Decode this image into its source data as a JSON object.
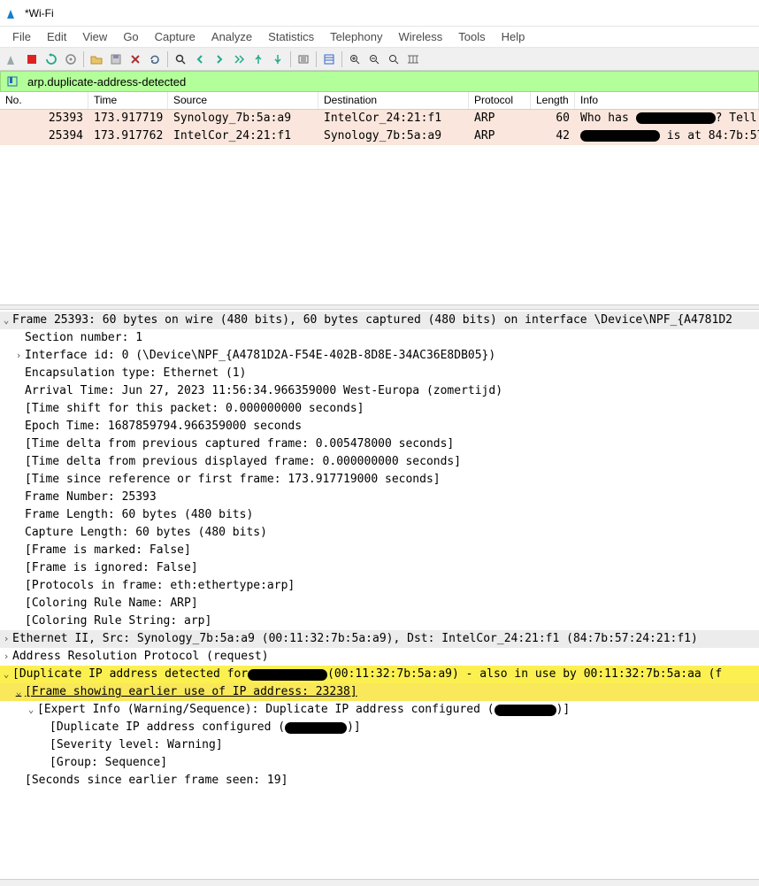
{
  "window": {
    "title": "*Wi-Fi"
  },
  "menu": {
    "items": [
      "File",
      "Edit",
      "View",
      "Go",
      "Capture",
      "Analyze",
      "Statistics",
      "Telephony",
      "Wireless",
      "Tools",
      "Help"
    ]
  },
  "toolbar": {
    "icons": [
      "shark-fin-icon",
      "stop-record-icon",
      "restart-icon",
      "options-icon",
      "sep",
      "open-icon",
      "save-icon",
      "close-icon",
      "reload-icon",
      "sep",
      "find-icon",
      "prev-icon",
      "next-icon",
      "jump-icon",
      "first-icon",
      "last-icon",
      "sep",
      "auto-scroll-icon",
      "sep",
      "colorize-icon",
      "sep",
      "zoom-in-icon",
      "zoom-out-icon",
      "zoom-reset-icon",
      "resize-cols-icon"
    ]
  },
  "filter": {
    "value": "arp.duplicate-address-detected"
  },
  "columns": {
    "no": "No.",
    "time": "Time",
    "source": "Source",
    "destination": "Destination",
    "protocol": "Protocol",
    "length": "Length",
    "info": "Info"
  },
  "packets": [
    {
      "no": "25393",
      "time": "173.917719",
      "source": "Synology_7b:5a:a9",
      "destination": "IntelCor_24:21:f1",
      "protocol": "ARP",
      "length": "60",
      "info_pre": "Who has ",
      "info_post": "? Tell "
    },
    {
      "no": "25394",
      "time": "173.917762",
      "source": "IntelCor_24:21:f1",
      "destination": "Synology_7b:5a:a9",
      "protocol": "ARP",
      "length": "42",
      "info_pre": "",
      "info_post": " is at 84:7b:57:"
    }
  ],
  "details": {
    "frame_header": "Frame 25393: 60 bytes on wire (480 bits), 60 bytes captured (480 bits) on interface \\Device\\NPF_{A4781D2",
    "frame": [
      "Section number: 1",
      "Interface id: 0 (\\Device\\NPF_{A4781D2A-F54E-402B-8D8E-34AC36E8DB05})",
      "Encapsulation type: Ethernet (1)",
      "Arrival Time: Jun 27, 2023 11:56:34.966359000 West-Europa (zomertijd)",
      "[Time shift for this packet: 0.000000000 seconds]",
      "Epoch Time: 1687859794.966359000 seconds",
      "[Time delta from previous captured frame: 0.005478000 seconds]",
      "[Time delta from previous displayed frame: 0.000000000 seconds]",
      "[Time since reference or first frame: 173.917719000 seconds]",
      "Frame Number: 25393",
      "Frame Length: 60 bytes (480 bits)",
      "Capture Length: 60 bytes (480 bits)",
      "[Frame is marked: False]",
      "[Frame is ignored: False]",
      "[Protocols in frame: eth:ethertype:arp]",
      "[Coloring Rule Name: ARP]",
      "[Coloring Rule String: arp]"
    ],
    "eth_header": "Ethernet II, Src: Synology_7b:5a:a9 (00:11:32:7b:5a:a9), Dst: IntelCor_24:21:f1 (84:7b:57:24:21:f1)",
    "arp_header": "Address Resolution Protocol (request)",
    "dup_header_pre": "[Duplicate IP address detected for ",
    "dup_header_post": " (00:11:32:7b:5a:a9) - also in use by 00:11:32:7b:5a:aa (f",
    "dup_frame_link": "[Frame showing earlier use of IP address: 23238]",
    "expert_pre": "[Expert Info (Warning/Sequence): Duplicate IP address configured (",
    "expert_post": ")]",
    "dup_conf_pre": "[Duplicate IP address configured (",
    "dup_conf_post": ")]",
    "severity": "[Severity level: Warning]",
    "group": "[Group: Sequence]",
    "seconds": "[Seconds since earlier frame seen: 19]"
  }
}
